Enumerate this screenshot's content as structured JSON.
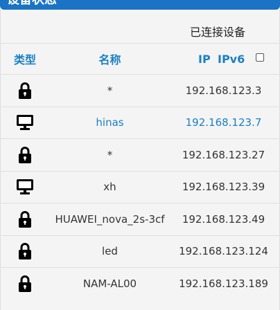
{
  "header": {
    "title": "设备状态",
    "subtitle": "已连接设备"
  },
  "columns": {
    "type": "类型",
    "name": "名称",
    "ip": "IP",
    "ipv6": "IPv6"
  },
  "ipv6_checkbox_checked": false,
  "devices": [
    {
      "icon": "lock-icon",
      "name": "*",
      "ip": "192.168.123.3",
      "highlight": false
    },
    {
      "icon": "monitor-icon",
      "name": "hinas",
      "ip": "192.168.123.7",
      "highlight": true
    },
    {
      "icon": "lock-icon",
      "name": "*",
      "ip": "192.168.123.27",
      "highlight": false
    },
    {
      "icon": "monitor-icon",
      "name": "xh",
      "ip": "192.168.123.39",
      "highlight": false
    },
    {
      "icon": "lock-icon",
      "name": "HUAWEI_nova_2s-3cf",
      "ip": "192.168.123.49",
      "highlight": false
    },
    {
      "icon": "lock-icon",
      "name": "led",
      "ip": "192.168.123.124",
      "highlight": false
    },
    {
      "icon": "lock-icon",
      "name": "NAM-AL00",
      "ip": "192.168.123.189",
      "highlight": false
    }
  ],
  "colors": {
    "accent": "#1a80c4",
    "header_bar": "#1a73c4"
  }
}
